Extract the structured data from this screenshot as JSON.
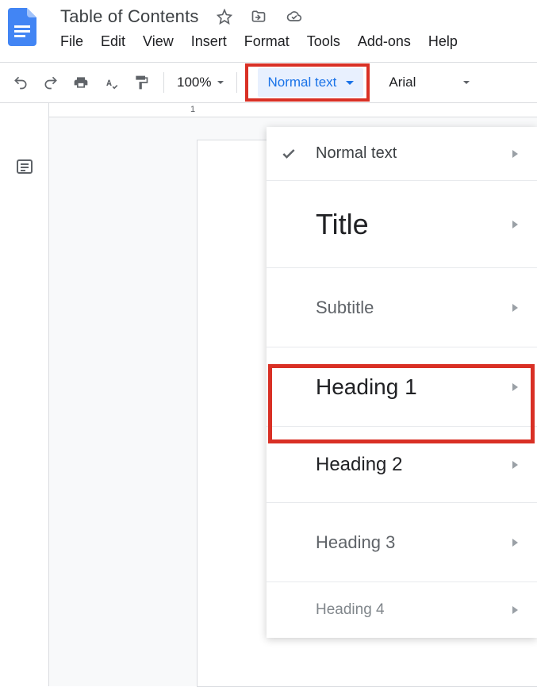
{
  "doc_title": "Table of Contents",
  "menus": [
    "File",
    "Edit",
    "View",
    "Insert",
    "Format",
    "Tools",
    "Add-ons",
    "Help"
  ],
  "zoom": "100%",
  "style_dropdown": "Normal text",
  "font_dropdown": "Arial",
  "ruler_mark": "1",
  "styles": {
    "normal": "Normal text",
    "title": "Title",
    "subtitle": "Subtitle",
    "h1": "Heading 1",
    "h2": "Heading 2",
    "h3": "Heading 3",
    "h4": "Heading 4"
  }
}
